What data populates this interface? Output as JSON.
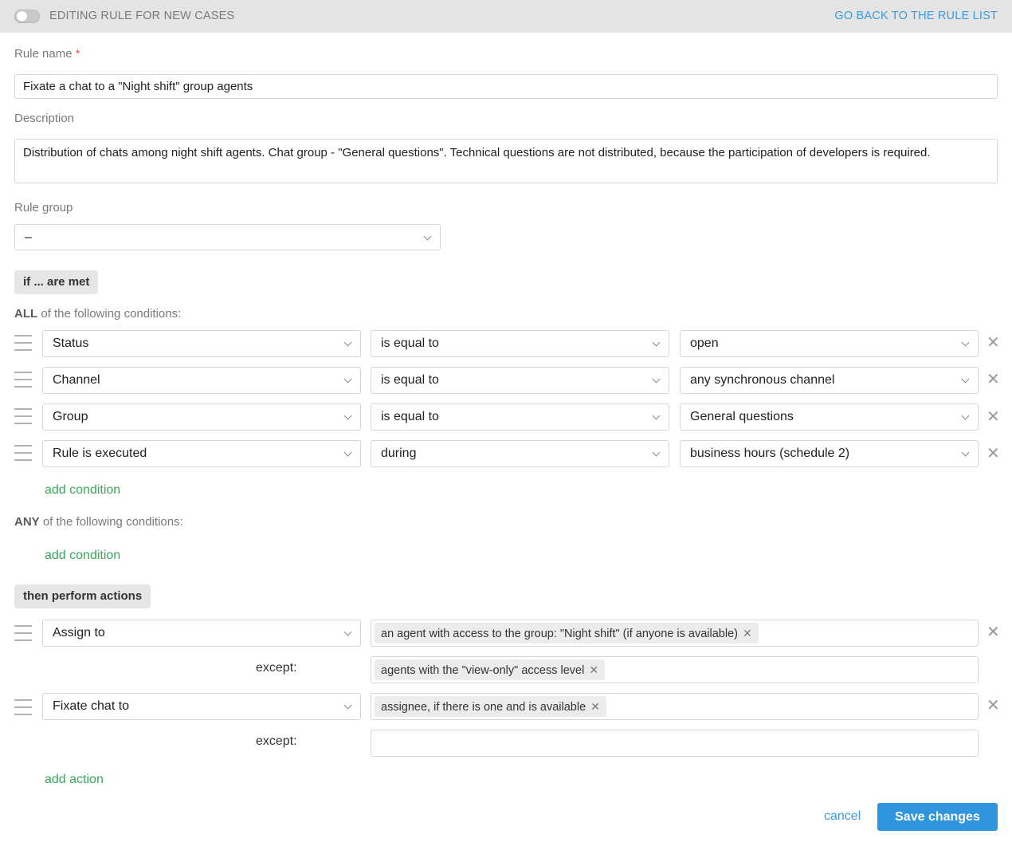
{
  "header": {
    "title": "EDITING RULE FOR NEW CASES",
    "back_link": "GO BACK TO THE RULE LIST",
    "toggle_on": false
  },
  "form": {
    "rule_name_label": "Rule name",
    "required_mark": "*",
    "rule_name_value": "Fixate a chat to a \"Night shift\" group agents",
    "description_label": "Description",
    "description_value": "Distribution of chats among night shift agents. Chat group - \"General questions\". Technical questions are not distributed, because the participation of developers is required.",
    "rule_group_label": "Rule group",
    "rule_group_value": "–"
  },
  "conditions": {
    "section_label": "if ... are met",
    "all_keyword": "ALL",
    "all_suffix": " of the following conditions:",
    "all_rows": [
      {
        "field": "Status",
        "operator": "is equal to",
        "value": "open"
      },
      {
        "field": "Channel",
        "operator": "is equal to",
        "value": "any synchronous channel"
      },
      {
        "field": "Group",
        "operator": "is equal to",
        "value": "General questions"
      },
      {
        "field": "Rule is executed",
        "operator": "during",
        "value": "business hours (schedule 2)"
      }
    ],
    "add_condition_label": "add condition",
    "any_keyword": "ANY",
    "any_suffix": " of the following conditions:"
  },
  "actions": {
    "section_label": "then perform actions",
    "rows": [
      {
        "action": "Assign to",
        "target_chip": "an agent with access to the group: \"Night shift\" (if anyone is available)",
        "except_label": "except:",
        "except_chip": "agents with the \"view-only\" access level"
      },
      {
        "action": "Fixate chat to",
        "target_chip": "assignee, if there is one and is available",
        "except_label": "except:",
        "except_chip": ""
      }
    ],
    "add_action_label": "add action"
  },
  "footer": {
    "cancel_label": "cancel",
    "save_label": "Save changes"
  },
  "icons": {
    "remove": "✕",
    "chip_remove": "✕"
  },
  "colors": {
    "accent_blue": "#2f95dc",
    "link_green": "#3aa65a",
    "required_red": "#e05a5a"
  }
}
